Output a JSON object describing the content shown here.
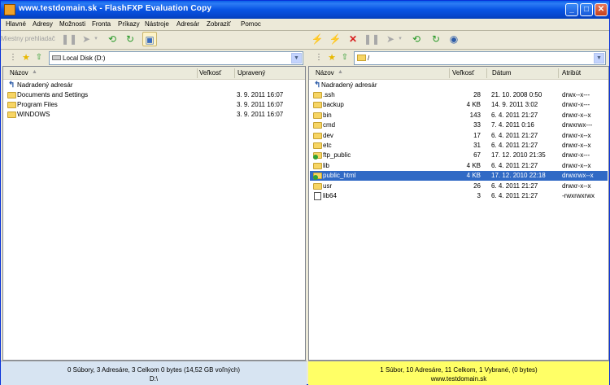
{
  "window": {
    "title": "www.testdomain.sk - FlashFXP Evaluation Copy",
    "minimize": "_",
    "maximize": "□",
    "close": "✕"
  },
  "menu": [
    "Hlavné",
    "Adresy",
    "Možnosti",
    "Fronta",
    "Príkazy",
    "Nástroje",
    "Adresár",
    "Zobraziť",
    "Pomoc"
  ],
  "left": {
    "toolbar_label": "Miestny prehliadač",
    "path": "Local Disk (D:)",
    "columns": {
      "name": "Názov",
      "size": "Veľkosť",
      "modified": "Upravený"
    },
    "parent_label": "Nadradený adresár",
    "rows": [
      {
        "name": "Documents and Settings",
        "size": "",
        "modified": "3. 9. 2011 16:07"
      },
      {
        "name": "Program Files",
        "size": "",
        "modified": "3. 9. 2011 16:07"
      },
      {
        "name": "WINDOWS",
        "size": "",
        "modified": "3. 9. 2011 16:07"
      }
    ],
    "status_line1": "0 Súbory, 3 Adresáre, 3 Celkom 0 bytes (14,52 GB voľných)",
    "status_line2": "D:\\"
  },
  "right": {
    "path": "/",
    "columns": {
      "name": "Názov",
      "size": "Veľkosť",
      "date": "Dátum",
      "attr": "Atribút"
    },
    "parent_label": "Nadradený adresár",
    "rows": [
      {
        "name": ".ssh",
        "size": "28",
        "date": "21. 10. 2008 0:50",
        "attr": "drwx--x---",
        "icon": "folder"
      },
      {
        "name": "backup",
        "size": "4 KB",
        "date": "14. 9. 2011 3:02",
        "attr": "drwxr-x---",
        "icon": "folder"
      },
      {
        "name": "bin",
        "size": "143",
        "date": "6. 4. 2011 21:27",
        "attr": "drwxr-x--x",
        "icon": "folder"
      },
      {
        "name": "cmd",
        "size": "33",
        "date": "7. 4. 2011 0:16",
        "attr": "drwxrwx---",
        "icon": "folder"
      },
      {
        "name": "dev",
        "size": "17",
        "date": "6. 4. 2011 21:27",
        "attr": "drwxr-x--x",
        "icon": "folder"
      },
      {
        "name": "etc",
        "size": "31",
        "date": "6. 4. 2011 21:27",
        "attr": "drwxr-x--x",
        "icon": "folder"
      },
      {
        "name": "ftp_public",
        "size": "67",
        "date": "17. 12. 2010 21:35",
        "attr": "drwxr-x---",
        "icon": "folder-green"
      },
      {
        "name": "lib",
        "size": "4 KB",
        "date": "6. 4. 2011 21:27",
        "attr": "drwxr-x--x",
        "icon": "folder"
      },
      {
        "name": "public_html",
        "size": "4 KB",
        "date": "17. 12. 2010 22:18",
        "attr": "drwxrwx--x",
        "icon": "folder-green",
        "selected": true
      },
      {
        "name": "usr",
        "size": "26",
        "date": "6. 4. 2011 21:27",
        "attr": "drwxr-x--x",
        "icon": "folder"
      },
      {
        "name": "lib64",
        "size": "3",
        "date": "6. 4. 2011 21:27",
        "attr": "-rwxrwxrwx",
        "icon": "file"
      }
    ],
    "status_line1": "1 Súbor, 10 Adresáre, 11 Celkom, 1 Vybrané, (0 bytes)",
    "status_line2": "www.testdomain.sk"
  },
  "colors": {
    "titlebar": "#0a5fe8",
    "selection": "#316ac5",
    "status_right": "#ffff66",
    "status_left": "#d7e4f2"
  }
}
